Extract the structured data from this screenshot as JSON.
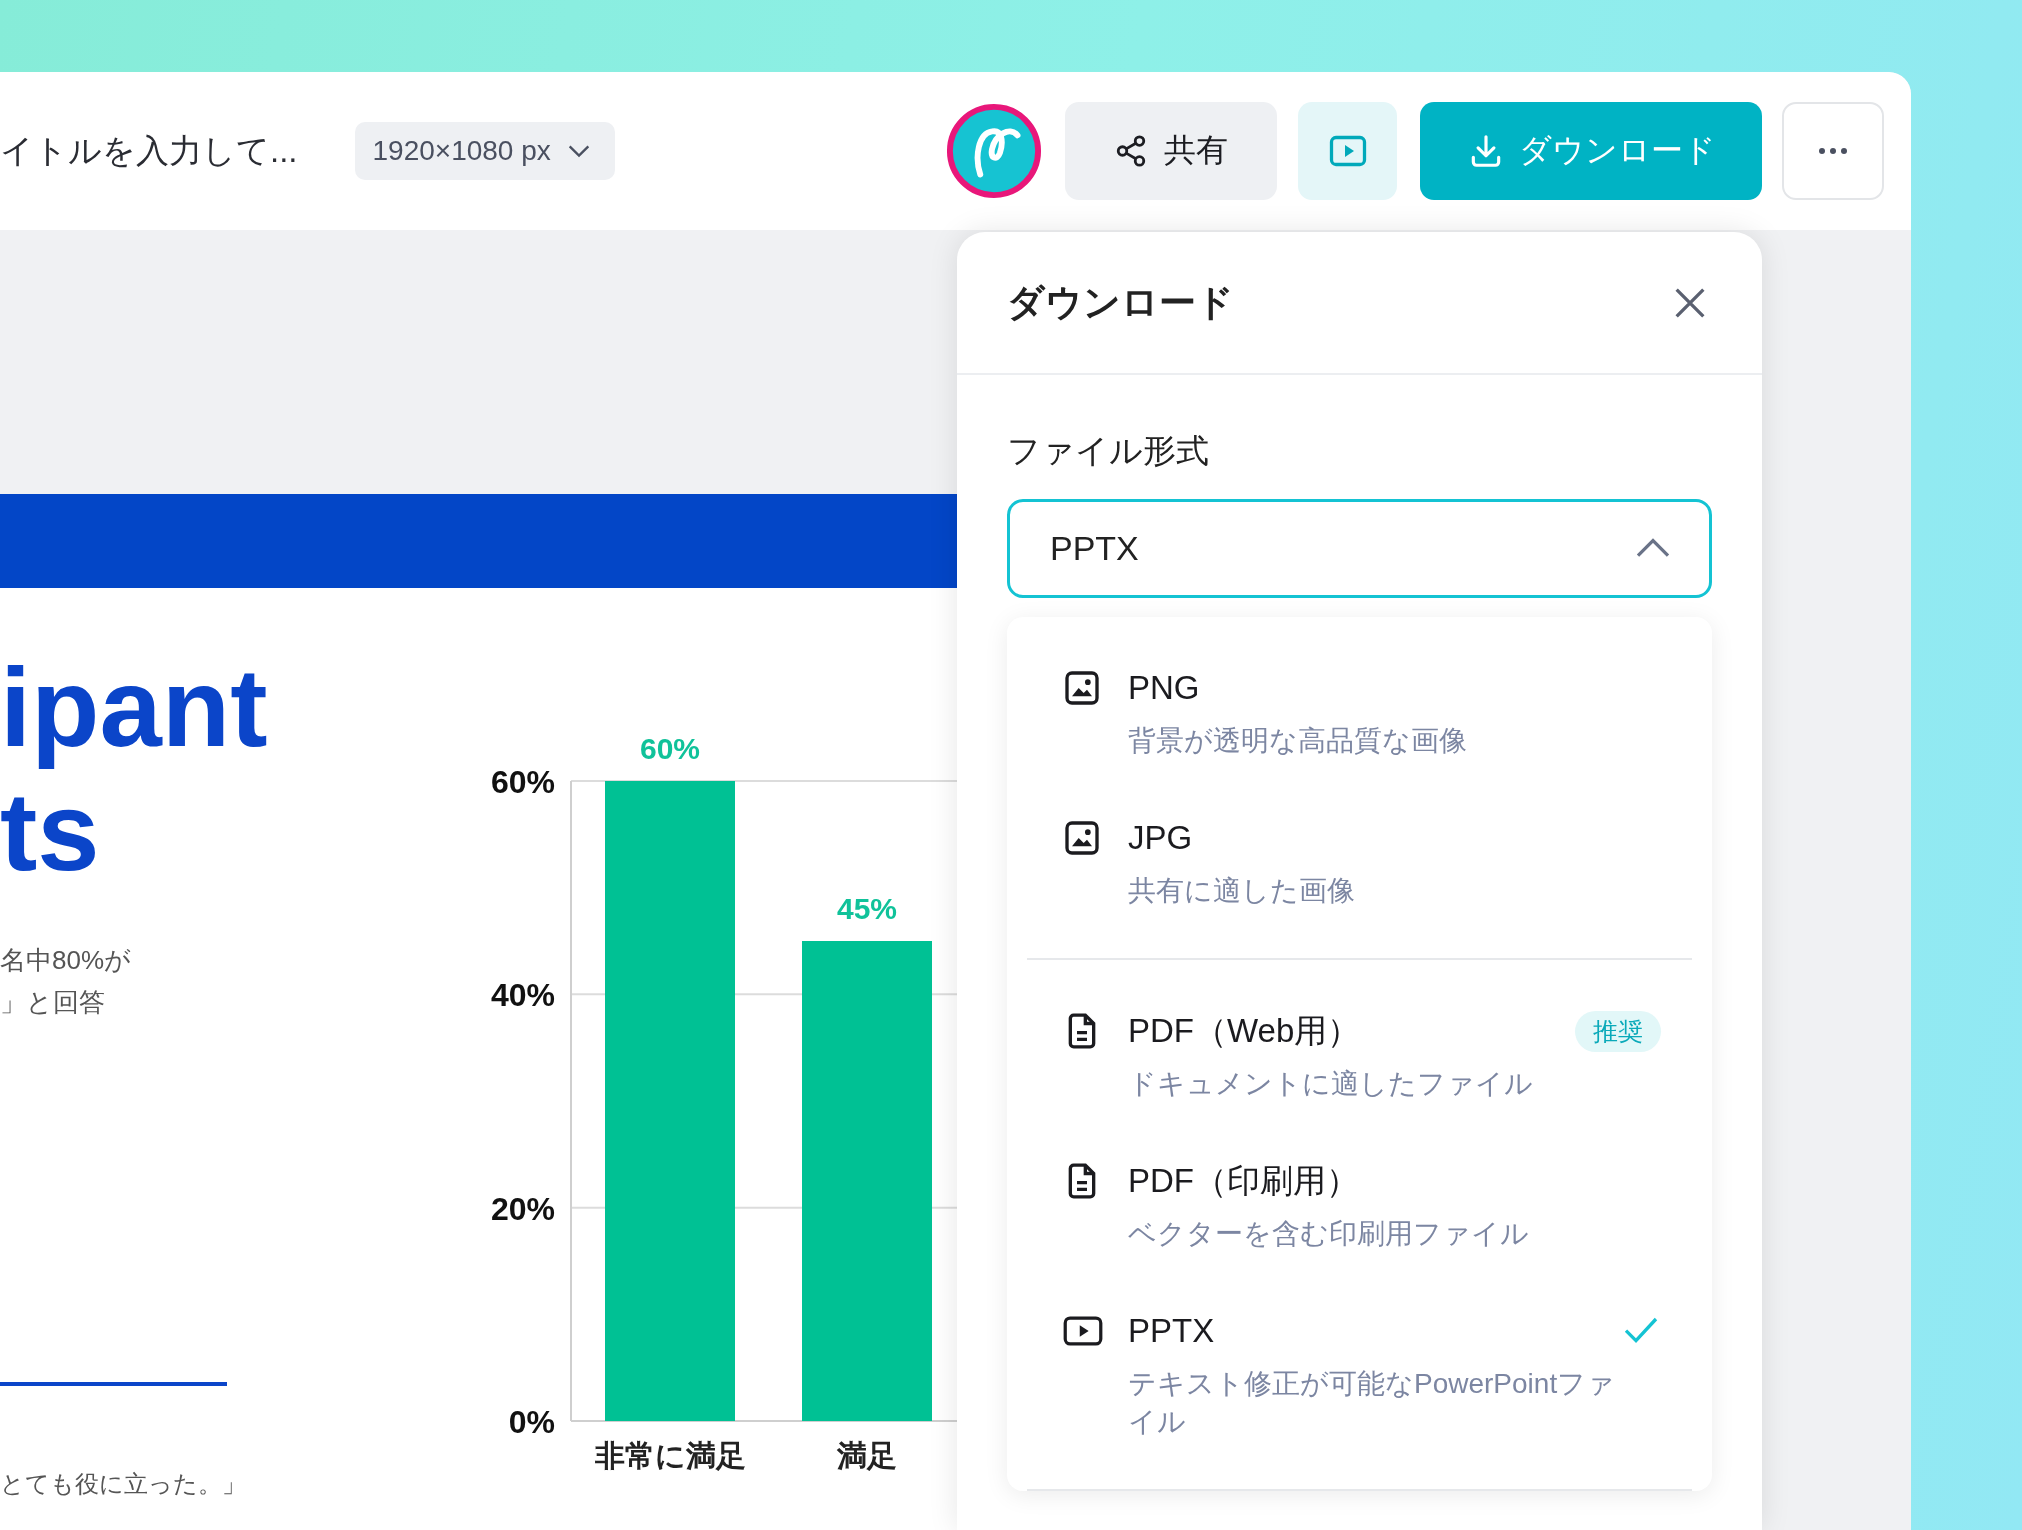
{
  "topbar": {
    "title": "イトルを入力して...",
    "size_select": "1920×1080 px",
    "share_button": "共有",
    "download_button": "ダウンロード"
  },
  "slide": {
    "title_lines": [
      "ipant",
      "ts"
    ],
    "body_lines": [
      "名中80%が",
      "」と回答"
    ],
    "quote": "とても役に立った。」",
    "chart_data": {
      "type": "bar",
      "categories": [
        "非常に満足",
        "満足"
      ],
      "values": [
        60,
        45
      ],
      "ylim": [
        0,
        60
      ],
      "yticks": [
        {
          "value": 0,
          "label": "0%"
        },
        {
          "value": 20,
          "label": "20%"
        },
        {
          "value": 40,
          "label": "40%"
        },
        {
          "value": 60,
          "label": "60%"
        }
      ],
      "value_labels": [
        "60%",
        "45%"
      ]
    }
  },
  "download_panel": {
    "title": "ダウンロード",
    "field_label": "ファイル形式",
    "format_select": {
      "value": "PPTX",
      "expanded": true
    },
    "option_groups": [
      {
        "options": [
          {
            "kind": "image",
            "label": "PNG",
            "description": "背景が透明な高品質な画像",
            "selected": false
          },
          {
            "kind": "image",
            "label": "JPG",
            "description": "共有に適した画像",
            "selected": false
          }
        ]
      },
      {
        "options": [
          {
            "kind": "document",
            "label": "PDF（Web用）",
            "badge": "推奨",
            "description": "ドキュメントに適したファイル",
            "selected": false
          },
          {
            "kind": "document",
            "label": "PDF（印刷用）",
            "description": "ベクターを含む印刷用ファイル",
            "selected": false
          },
          {
            "kind": "slides",
            "label": "PPTX",
            "description": "テキスト修正が可能なPowerPointファイル",
            "selected": true
          }
        ]
      }
    ]
  }
}
